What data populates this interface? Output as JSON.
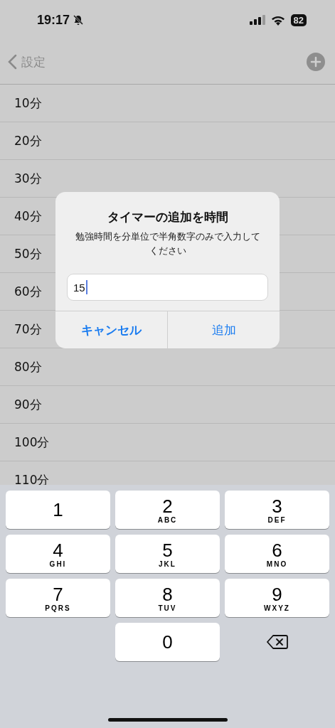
{
  "status_bar": {
    "time": "19:17",
    "battery": "82"
  },
  "nav": {
    "back_label": "設定"
  },
  "rows": [
    "10分",
    "20分",
    "30分",
    "40分",
    "50分",
    "60分",
    "70分",
    "80分",
    "90分",
    "100分",
    "110分"
  ],
  "dialog": {
    "title": "タイマーの追加を時間",
    "message": "勉強時間を分単位で半角数字のみで入力してください",
    "input": {
      "value": "15"
    },
    "buttons": [
      {
        "label": "キャンセル",
        "emphasized": true
      },
      {
        "label": "追加",
        "emphasized": false
      }
    ]
  },
  "keypad": [
    {
      "kind": "digit",
      "digit": "1"
    },
    {
      "kind": "digit",
      "digit": "2",
      "letters": "ABC"
    },
    {
      "kind": "digit",
      "digit": "3",
      "letters": "DEF"
    },
    {
      "kind": "digit",
      "digit": "4",
      "letters": "GHI"
    },
    {
      "kind": "digit",
      "digit": "5",
      "letters": "JKL"
    },
    {
      "kind": "digit",
      "digit": "6",
      "letters": "MNO"
    },
    {
      "kind": "digit",
      "digit": "7",
      "letters": "PQRS"
    },
    {
      "kind": "digit",
      "digit": "8",
      "letters": "TUV"
    },
    {
      "kind": "digit",
      "digit": "9",
      "letters": "WXYZ"
    },
    {
      "kind": "empty"
    },
    {
      "kind": "digit",
      "digit": "0"
    },
    {
      "kind": "delete"
    }
  ]
}
